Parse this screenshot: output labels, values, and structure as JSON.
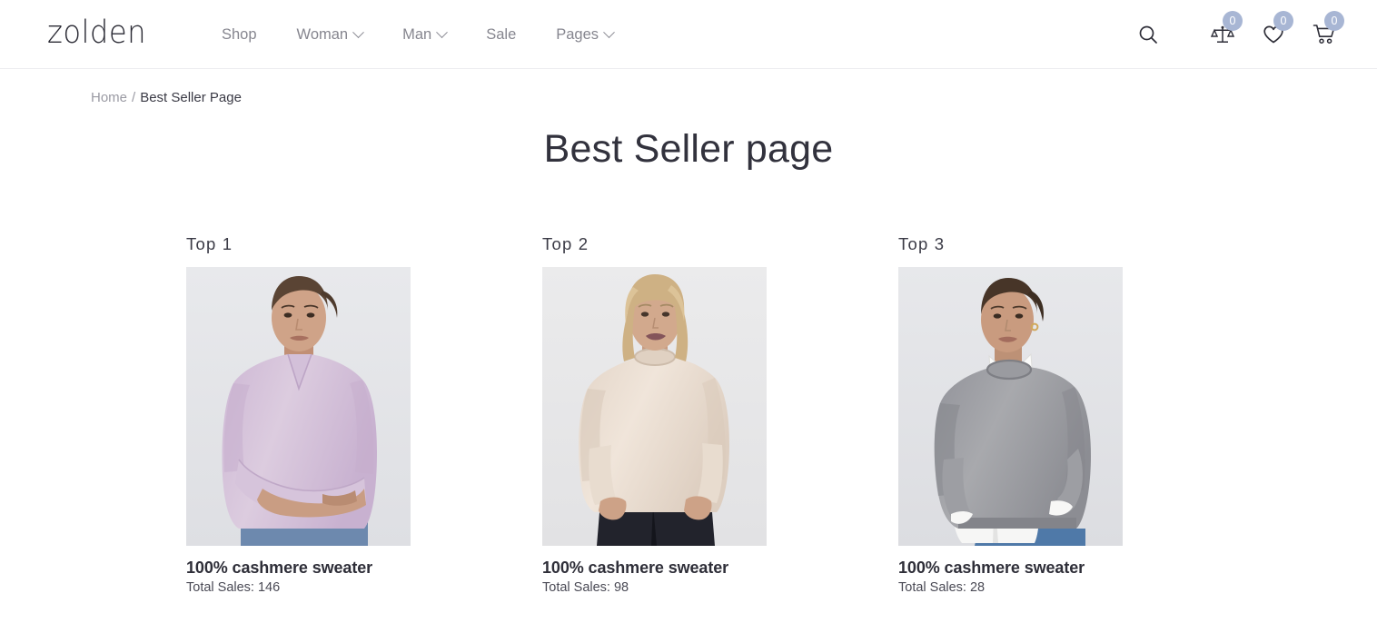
{
  "header": {
    "logo": "zolden",
    "nav": [
      {
        "label": "Shop",
        "has_dropdown": false,
        "icon": null
      },
      {
        "label": "Woman",
        "has_dropdown": true,
        "icon": "chevron-down-icon"
      },
      {
        "label": "Man",
        "has_dropdown": true,
        "icon": "chevron-down-icon"
      },
      {
        "label": "Sale",
        "has_dropdown": false,
        "icon": null
      },
      {
        "label": "Pages",
        "has_dropdown": true,
        "icon": "chevron-down-icon"
      }
    ],
    "actions": {
      "search": {
        "icon": "search-icon"
      },
      "compare": {
        "icon": "compare-scales-icon",
        "count": "0"
      },
      "wishlist": {
        "icon": "heart-icon",
        "count": "0"
      },
      "cart": {
        "icon": "shopping-cart-icon",
        "count": "0"
      }
    },
    "badge_color": "#a8b6d4"
  },
  "breadcrumb": {
    "home": "Home",
    "separator": "/",
    "current": "Best Seller Page"
  },
  "main": {
    "title": "Best Seller page",
    "products": [
      {
        "rank": "Top 1",
        "name": "100% cashmere sweater",
        "sales": "Total Sales: 146",
        "image": {
          "alt": "woman-in-lilac-cashmere-sweater",
          "background": "#e4e5e9",
          "garment_color": "#d8c6dd",
          "garment_shade": "#c9b2d1",
          "skin": "#c99d83",
          "hair": "#5a4434",
          "bottom": "#6d89ae"
        }
      },
      {
        "rank": "Top 2",
        "name": "100% cashmere sweater",
        "sales": "Total Sales: 98",
        "image": {
          "alt": "woman-in-cream-cashmere-sweater",
          "background": "#e8e8ea",
          "garment_color": "#ebdfd4",
          "garment_shade": "#ddcdbf",
          "skin": "#d2a98d",
          "hair": "#ceb184",
          "bottom": "#22232c"
        }
      },
      {
        "rank": "Top 3",
        "name": "100% cashmere sweater",
        "sales": "Total Sales: 28",
        "image": {
          "alt": "woman-in-grey-cashmere-sweater-over-white-shirt",
          "background": "#e3e4e7",
          "garment_color": "#9d9ea2",
          "garment_shade": "#88898e",
          "skin": "#c99b7f",
          "hair": "#473528",
          "bottom": "#4f79a8",
          "shirt": "#f6f6f5"
        }
      }
    ]
  }
}
